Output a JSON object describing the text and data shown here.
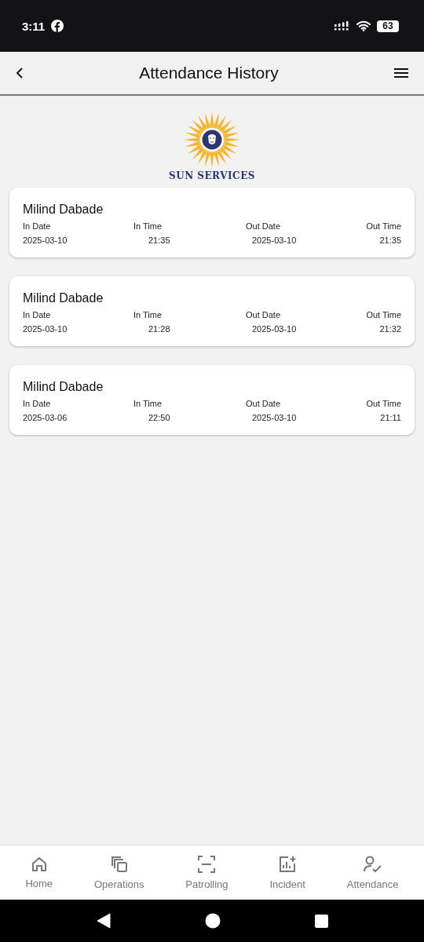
{
  "status_bar": {
    "time": "3:11",
    "battery": "63"
  },
  "header": {
    "title": "Attendance History"
  },
  "logo": {
    "text": "SUN SERVICES"
  },
  "records": [
    {
      "name": "Milind Dabade",
      "in_date_label": "In Date",
      "in_time_label": "In Time",
      "out_date_label": "Out Date",
      "out_time_label": "Out Time",
      "in_date": "2025-03-10",
      "in_time": "21:35",
      "out_date": "2025-03-10",
      "out_time": "21:35"
    },
    {
      "name": "Milind Dabade",
      "in_date_label": "In Date",
      "in_time_label": "In Time",
      "out_date_label": "Out Date",
      "out_time_label": "Out Time",
      "in_date": "2025-03-10",
      "in_time": "21:28",
      "out_date": "2025-03-10",
      "out_time": "21:32"
    },
    {
      "name": "Milind Dabade",
      "in_date_label": "In Date",
      "in_time_label": "In Time",
      "out_date_label": "Out Date",
      "out_time_label": "Out Time",
      "in_date": "2025-03-06",
      "in_time": "22:50",
      "out_date": "2025-03-10",
      "out_time": "21:11"
    }
  ],
  "bottom_nav": [
    {
      "kind": "home",
      "label": "Home"
    },
    {
      "kind": "operations",
      "label": "Operations"
    },
    {
      "kind": "patrolling",
      "label": "Patrolling"
    },
    {
      "kind": "incident",
      "label": "Incident"
    },
    {
      "kind": "attendance",
      "label": "Attendance"
    }
  ]
}
